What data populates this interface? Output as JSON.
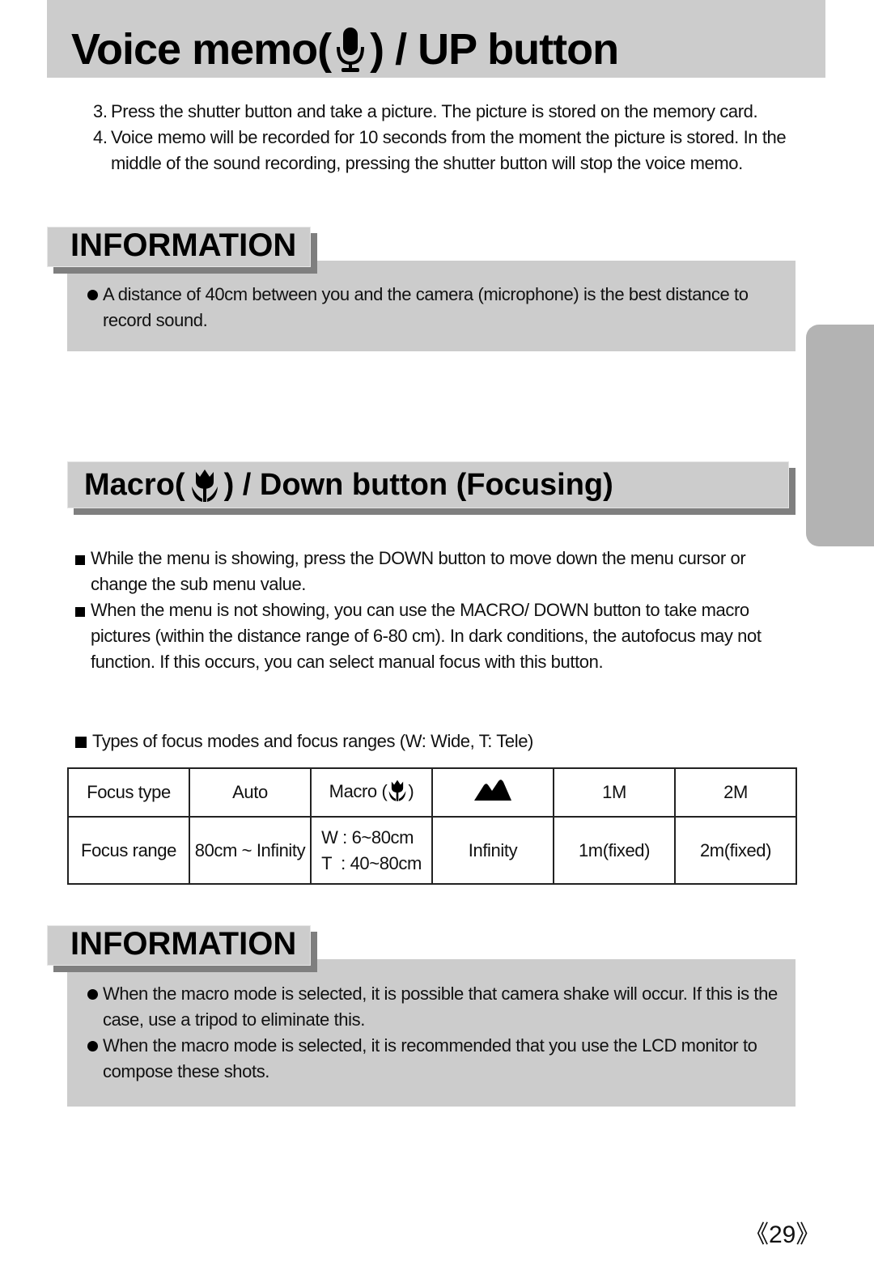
{
  "title": {
    "text_before": "Voice memo(",
    "icon": "microphone-icon",
    "text_after": ") / UP button"
  },
  "steps": [
    {
      "num": "3.",
      "text": "Press the shutter button and take a picture. The picture is stored on the memory card."
    },
    {
      "num": "4.",
      "text": "Voice memo will be recorded for 10 seconds from the moment the picture is stored. In the middle of the sound recording, pressing the shutter button will stop the voice memo."
    }
  ],
  "info1": {
    "label": "INFORMATION",
    "bullets": [
      "A distance of 40cm between you and the camera (microphone) is the best distance to record sound."
    ]
  },
  "macro_section": {
    "heading_before": "Macro(",
    "icon": "macro-flower-icon",
    "heading_after": ") / Down button (Focusing)",
    "bullets": [
      "While the menu is showing, press the DOWN button to move down the menu cursor or change the sub menu value.",
      "When the menu is not showing, you can use the MACRO/ DOWN button to take macro pictures (within the distance range of 6-80 cm). In dark conditions, the autofocus may not function. If this occurs, you can select manual focus with this button."
    ],
    "table_intro": "Types of focus modes and focus ranges (W: Wide, T: Tele)"
  },
  "focus_table": {
    "row_labels": [
      "Focus type",
      "Focus range"
    ],
    "types": [
      "Auto",
      "Macro (",
      "",
      "1M",
      "2M"
    ],
    "type_close": ")",
    "type_icons": [
      "",
      "macro-flower-icon",
      "mountain-infinity-icon",
      "",
      ""
    ],
    "ranges": [
      "80cm ~ Infinity",
      "",
      "Infinity",
      "1m(fixed)",
      "2m(fixed)"
    ],
    "macro_range_w": "W : 6~80cm",
    "macro_range_t": "T  : 40~80cm"
  },
  "info2": {
    "label": "INFORMATION",
    "bullets": [
      "When the macro mode is selected, it is possible that camera shake will occur. If this is the case, use a tripod to eliminate this.",
      "When the macro mode is selected, it is recommended that you use the LCD monitor to compose these shots."
    ]
  },
  "page_number": "《29》",
  "colors": {
    "panel_gray": "#cccccc",
    "shadow_gray": "#7f7f7f",
    "side_tab_gray": "#b3b3b3"
  }
}
